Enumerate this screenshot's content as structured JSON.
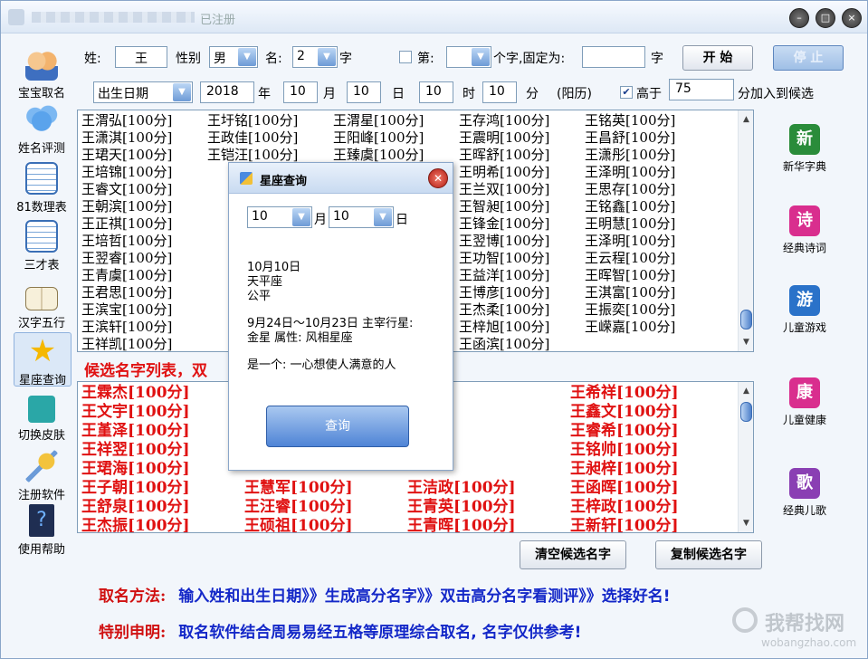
{
  "window": {
    "title_suffix": "已注册",
    "min": "–",
    "max": "□",
    "close": "×"
  },
  "left_nav": [
    {
      "label": "宝宝取名",
      "icon": "baby-names-icon"
    },
    {
      "label": "姓名评测",
      "icon": "cloud-icon"
    },
    {
      "label": "81数理表",
      "icon": "table-icon"
    },
    {
      "label": "三才表",
      "icon": "table-icon"
    },
    {
      "label": "汉字五行",
      "icon": "book-icon"
    },
    {
      "label": "星座查询",
      "icon": "star-icon"
    },
    {
      "label": "切换皮肤",
      "icon": "shirt-icon"
    },
    {
      "label": "注册软件",
      "icon": "key-icon"
    },
    {
      "label": "使用帮助",
      "icon": "help-icon"
    }
  ],
  "form": {
    "surname_label": "姓:",
    "surname_value": "王",
    "gender_label": "性别",
    "gender_value": "男",
    "name_label": "名:",
    "name_len_value": "2",
    "name_len_unit": "字",
    "fixed_label": "第:",
    "fixed_suffix": "个字,固定为:",
    "fixed_unit": "字",
    "start_button": "开 始",
    "stop_button": "停 止",
    "birth_select": "出生日期",
    "year": "2018",
    "year_unit": "年",
    "month": "10",
    "month_unit": "月",
    "day": "10",
    "day_unit": "日",
    "hour": "10",
    "hour_unit": "时",
    "minute": "10",
    "minute_unit": "分",
    "calendar": "(阳历)",
    "above_label": "高于",
    "above_value": "75",
    "above_suffix": "分加入到候选"
  },
  "results": {
    "columns": [
      [
        "王渭弘[100分]",
        "王潇淇[100分]",
        "王珺天[100分]",
        "王培锦[100分]",
        "王睿文[100分]",
        "王朝滨[100分]",
        "王正祺[100分]",
        "王培哲[100分]",
        "王翌睿[100分]",
        "王青虞[100分]",
        "王君思[100分]",
        "王滨宝[100分]",
        "王滨轩[100分]",
        "王祥凯[100分]"
      ],
      [
        "王圩铭[100分]",
        "王政佳[100分]",
        "王铠汪[100分]"
      ],
      [
        "王渭星[100分]",
        "王阳峰[100分]",
        "王臻虞[100分]"
      ],
      [
        "王存鸿[100分]",
        "王震明[100分]",
        "王晖舒[100分]",
        "王明希[100分]",
        "王兰双[100分]",
        "王智昶[100分]",
        "王锋金[100分]",
        "王翌博[100分]",
        "王功智[100分]",
        "王益洋[100分]",
        "王博彦[100分]",
        "王杰柔[100分]",
        "王梓旭[100分]",
        "王函滨[100分]"
      ],
      [
        "王铭英[100分]",
        "王昌舒[100分]",
        "王潇彤[100分]",
        "王泽明[100分]",
        "王思存[100分]",
        "王铭鑫[100分]",
        "王明慧[100分]",
        "王泽明[100分]",
        "王云程[100分]",
        "王晖智[100分]",
        "王淇富[100分]",
        "王振奕[100分]",
        "王嵘嘉[100分]"
      ]
    ]
  },
  "candidates": {
    "header": "候选名字列表，双",
    "columns": [
      [
        "王霖杰[100分]",
        "王文宇[100分]",
        "王堇泽[100分]",
        "王祥翌[100分]",
        "王珺海[100分]",
        "王子朝[100分]",
        "王舒泉[100分]",
        "王杰振[100分]"
      ],
      [
        "王慧军[100分]",
        "王汪睿[100分]",
        "王硕祖[100分]"
      ],
      [
        "王洁政[100分]",
        "王青英[100分]",
        "王青晖[100分]"
      ],
      [
        "王希祥[100分]",
        "王鑫文[100分]",
        "王睿希[100分]",
        "王铭帅[100分]",
        "王昶梓[100分]",
        "王函晖[100分]",
        "王梓政[100分]",
        "王新轩[100分]"
      ]
    ],
    "clear_button": "清空候选名字",
    "copy_button": "复制候选名字"
  },
  "right_nav": [
    {
      "label": "新华字典",
      "glyph": "新",
      "color": "#2a8c3a"
    },
    {
      "label": "经典诗词",
      "glyph": "诗",
      "color": "#d92e8e"
    },
    {
      "label": "儿童游戏",
      "glyph": "游",
      "color": "#2a72c9"
    },
    {
      "label": "儿童健康",
      "glyph": "康",
      "color": "#d92e8e"
    },
    {
      "label": "经典儿歌",
      "glyph": "歌",
      "color": "#8a3fb3"
    }
  ],
  "dialog": {
    "title": "星座查询",
    "month": "10",
    "month_unit": "月",
    "day": "10",
    "day_unit": "日",
    "line1": "10月10日",
    "line2": "天平座",
    "line3": "公平",
    "line4": "9月24日～10月23日 主宰行星:",
    "line5": "金星 属性: 风相星座",
    "line6": "是一个: 一心想使人满意的人",
    "query_button": "查询"
  },
  "footer": {
    "method_label": "取名方法:",
    "method_text": "输入姓和出生日期》》生成高分名字》》双击高分名字看测评》》选择好名!",
    "notice_label": "特别申明:",
    "notice_text": "取名软件结合周易易经五格等原理综合取名, 名字仅供参考!"
  },
  "watermark": {
    "text": "我帮找网",
    "url": "wobangzhao.com"
  },
  "colors": {
    "candidate_red": "#e01212",
    "footer_label": "#d01010",
    "footer_text": "#1428c8"
  }
}
